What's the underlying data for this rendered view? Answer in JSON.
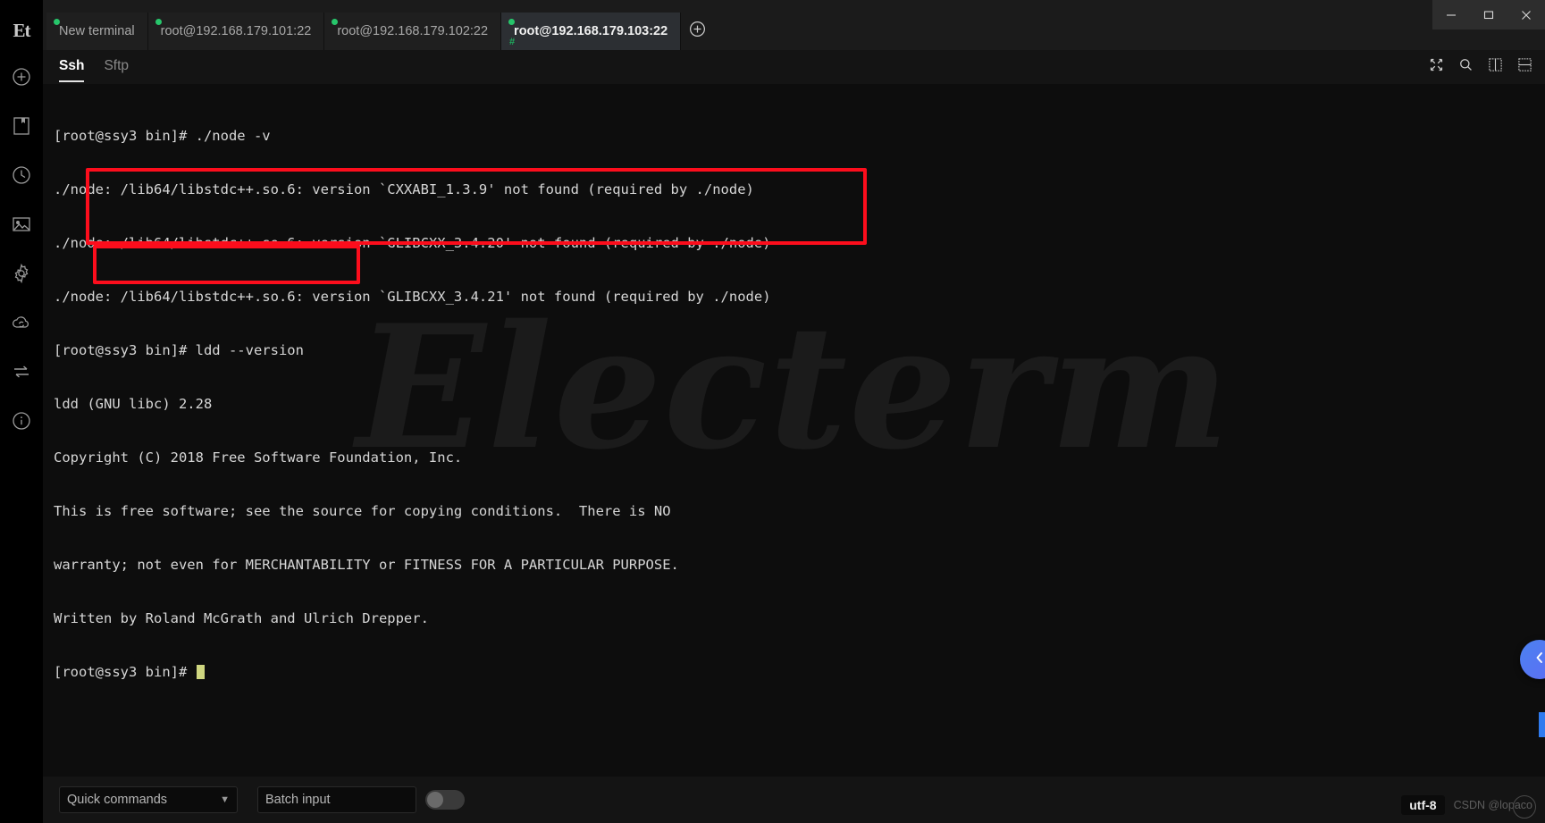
{
  "window": {
    "controls": [
      {
        "name": "minimize",
        "glyph": "–"
      },
      {
        "name": "maximize",
        "glyph": "❐"
      },
      {
        "name": "close",
        "glyph": "✕"
      }
    ]
  },
  "sidebar": {
    "logo": "Et",
    "items": [
      {
        "icon": "plus-circle-icon",
        "label": "New session"
      },
      {
        "icon": "bookmark-icon",
        "label": "Bookmarks"
      },
      {
        "icon": "clock-icon",
        "label": "History"
      },
      {
        "icon": "image-icon",
        "label": "Theme"
      },
      {
        "icon": "gear-icon",
        "label": "Settings"
      },
      {
        "icon": "cloud-sync-icon",
        "label": "Sync"
      },
      {
        "icon": "transfer-icon",
        "label": "Transfer"
      },
      {
        "icon": "info-icon",
        "label": "About"
      }
    ]
  },
  "tabs": {
    "items": [
      {
        "title": "New terminal",
        "active": false,
        "status": "connected"
      },
      {
        "title": "root@192.168.179.101:22",
        "active": false,
        "status": "connected"
      },
      {
        "title": "root@192.168.179.102:22",
        "active": false,
        "status": "connected"
      },
      {
        "title": "root@192.168.179.103:22",
        "active": true,
        "status": "connected"
      }
    ],
    "add_label": "+"
  },
  "subtabs": {
    "items": [
      {
        "label": "Ssh",
        "active": true
      },
      {
        "label": "Sftp",
        "active": false
      }
    ],
    "tools": [
      {
        "icon": "fullscreen-icon",
        "label": "Full screen"
      },
      {
        "icon": "search-icon",
        "label": "Search"
      },
      {
        "icon": "split-vertical-icon",
        "label": "Split vertical"
      },
      {
        "icon": "split-grid-icon",
        "label": "Split grid"
      }
    ]
  },
  "terminal": {
    "watermark": "Electerm",
    "lines": [
      "[root@ssy3 bin]# ./node -v",
      "./node: /lib64/libstdc++.so.6: version `CXXABI_1.3.9' not found (required by ./node)",
      "./node: /lib64/libstdc++.so.6: version `GLIBCXX_3.4.20' not found (required by ./node)",
      "./node: /lib64/libstdc++.so.6: version `GLIBCXX_3.4.21' not found (required by ./node)",
      "[root@ssy3 bin]# ldd --version",
      "ldd (GNU libc) 2.28",
      "Copyright (C) 2018 Free Software Foundation, Inc.",
      "This is free software; see the source for copying conditions.  There is NO",
      "warranty; not even for MERCHANTABILITY or FITNESS FOR A PARTICULAR PURPOSE.",
      "Written by Roland McGrath and Ulrich Drepper.",
      "[root@ssy3 bin]# "
    ],
    "prompt_last": "[root@ssy3 bin]# "
  },
  "annotations": {
    "boxes": [
      {
        "name": "node-version-error-highlight",
        "color": "#fc0d1c"
      },
      {
        "name": "ldd-version-highlight",
        "color": "#fc0d1c"
      }
    ]
  },
  "bottombar": {
    "quick_commands_label": "Quick commands",
    "batch_input_placeholder": "Batch input",
    "batch_toggle_on": false,
    "encoding": "utf-8",
    "watermark": "CSDN @lopaco"
  },
  "collapse_handle": {
    "icon": "chevron-left-icon",
    "accent": "#4b82f0"
  }
}
